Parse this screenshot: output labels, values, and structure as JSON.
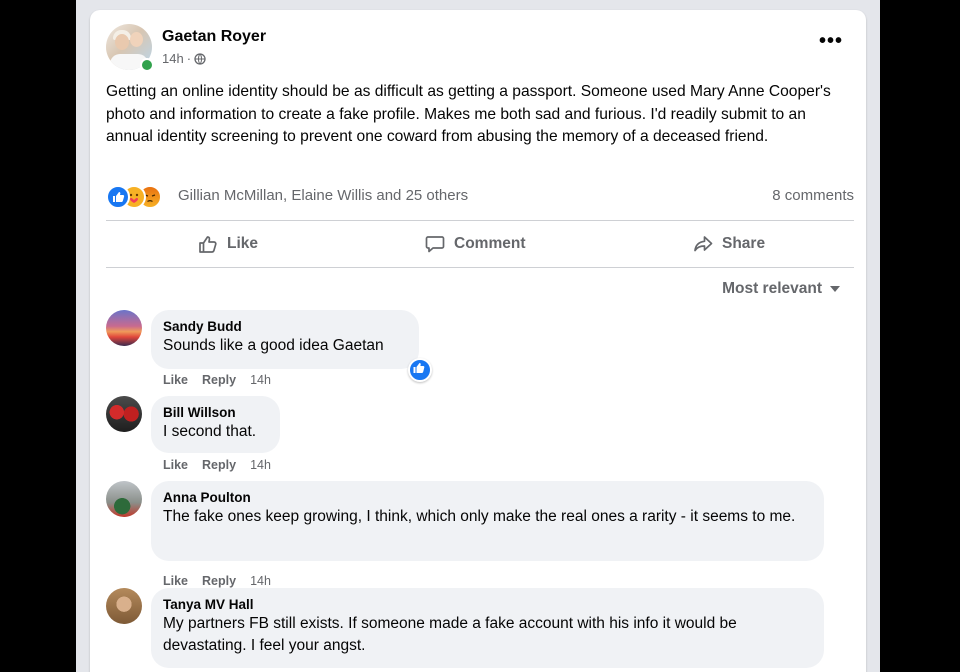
{
  "post": {
    "author": "Gaetan Royer",
    "time": "14h",
    "text": "Getting an online identity should be as difficult as getting a passport. Someone used Mary Anne Cooper's photo and information to create a fake profile. Makes me both sad and furious. I'd readily submit to an annual identity screening to prevent one coward from abusing the memory of a deceased friend.",
    "more_label": "•••",
    "reactions_summary": "Gillian McMillan, Elaine Willis and 25 others",
    "comment_count": "8 comments",
    "reaction_icons": [
      "like-icon",
      "care-icon",
      "angry-icon"
    ]
  },
  "actions": {
    "like": "Like",
    "comment": "Comment",
    "share": "Share"
  },
  "sort_label": "Most relevant",
  "comments": [
    {
      "name": "Sandy Budd",
      "text": "Sounds like a good idea Gaetan",
      "like": "Like",
      "reply": "Reply",
      "time": "14h"
    },
    {
      "name": "Bill Willson",
      "text": "I second that.",
      "like": "Like",
      "reply": "Reply",
      "time": "14h"
    },
    {
      "name": "Anna Poulton",
      "text": "The fake ones keep growing, I think, which only make the real ones a rarity - it seems to me.",
      "like": "Like",
      "reply": "Reply",
      "time": "14h"
    },
    {
      "name": "Tanya MV Hall",
      "text": "My partners FB still exists. If someone made a fake account with his info it would be devastating. I feel your angst."
    }
  ],
  "colors": {
    "accent": "#1877f2",
    "online": "#31a24c",
    "secondary_text": "#65676b",
    "bubble": "#f0f2f5"
  }
}
